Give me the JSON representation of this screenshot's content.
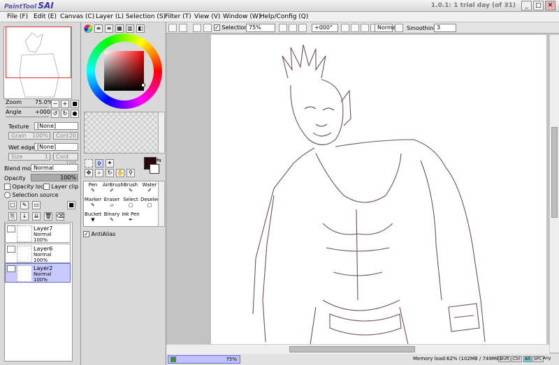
{
  "app": {
    "logo_text": "PaintTool",
    "logo_brand": "SAI",
    "title": "1.0.1: 1 trial day (of 31)"
  },
  "window": {
    "minimize": "_",
    "maximize": "□",
    "close": "✕"
  },
  "menu": [
    "File (F)",
    "Edit (E)",
    "Canvas (C)",
    "Layer (L)",
    "Selection (S)",
    "Filter (T)",
    "View (V)",
    "Window (W)",
    "Help/Config (Q)"
  ],
  "nav": {
    "zoom_label": "Zoom",
    "zoom_value": "75.0%",
    "angle_label": "Angle",
    "angle_value": "+000R"
  },
  "texture": {
    "label": "Texture",
    "value": "[None]",
    "grain_label": "Grain",
    "grain_value": "100%",
    "cont_label": "Cont",
    "cont_value": "20"
  },
  "wetedge": {
    "label": "Wet edge",
    "value": "[None]",
    "size_label": "Size",
    "size_value": "1",
    "cont_label": "Cont",
    "cont_value": "100"
  },
  "blend": {
    "label": "Blend mode",
    "value": "Normal",
    "opacity_label": "Opacity",
    "opacity_value": "100%"
  },
  "options": {
    "opacity_lock": "Opacity lock",
    "layer_clip": "Layer clip",
    "selection_source": "Selection source"
  },
  "layers": [
    {
      "name": "Layer7",
      "mode": "Normal",
      "opacity": "100%",
      "selected": false
    },
    {
      "name": "Layer6",
      "mode": "Normal",
      "opacity": "100%",
      "selected": false
    },
    {
      "name": "Layer2",
      "mode": "Normal",
      "opacity": "100%",
      "selected": true
    }
  ],
  "tools": [
    [
      "Pen",
      "AirBrush",
      "Brush",
      "Water"
    ],
    [
      "Marker",
      "Eraser",
      "Select",
      "Deselect"
    ],
    [
      "Bucket",
      "Binary",
      "Ink Pen",
      ""
    ]
  ],
  "antialias": "AntiAlias",
  "toolbar": {
    "selection_label": "Selection",
    "zoom": "75%",
    "rotation": "+000°",
    "blend": "Normal",
    "smoothing_label": "Smoothing",
    "smoothing_value": "3"
  },
  "status": {
    "tab_label": "75%",
    "memory": "Memory load:62% (102MB / 749MB)",
    "keys": [
      "Shift",
      "Ctrl",
      "Alt",
      "SPC"
    ],
    "any": "Any"
  },
  "colors": {
    "current_color": "#2a0808",
    "accent": "#6a6adf"
  }
}
